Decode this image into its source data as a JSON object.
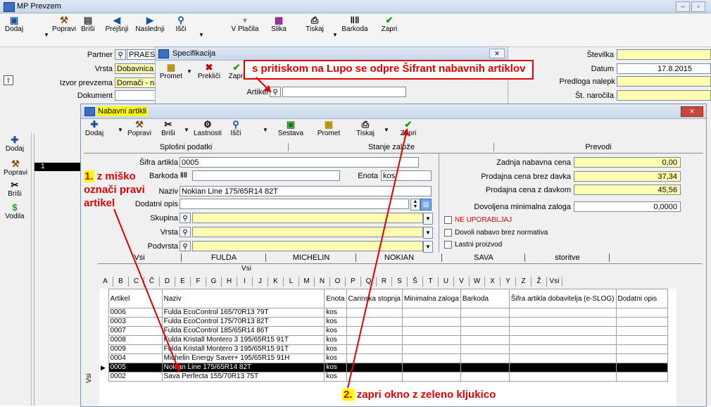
{
  "main_window": {
    "title": "MP Prevzem",
    "toolbar": [
      {
        "label": "Dodaj",
        "icon": "add-doc-icon"
      },
      {
        "label": "Popravi",
        "icon": "hammer-icon"
      },
      {
        "label": "Briši",
        "icon": "delete-icon"
      },
      {
        "label": "Prejšnji",
        "icon": "prev-arrow-icon"
      },
      {
        "label": "Naslednji",
        "icon": "next-arrow-icon"
      },
      {
        "label": "Išči",
        "icon": "search-icon"
      },
      {
        "label": "V Plačila",
        "icon": "pay-icon"
      },
      {
        "label": "Slika",
        "icon": "picture-icon"
      },
      {
        "label": "Tiskaj",
        "icon": "print-icon"
      },
      {
        "label": "Barkoda",
        "icon": "barcode-icon"
      },
      {
        "label": "Zapri",
        "icon": "checkmark-icon"
      }
    ],
    "fields": {
      "partner_label": "Partner",
      "partner_value": "PRAEST",
      "vrsta_label": "Vrsta",
      "vrsta_value": "Dobavnica",
      "izvor_label": "Izvor prevzema",
      "izvor_value": "Domači - na",
      "dokument_label": "Dokument"
    },
    "right_fields": {
      "stevilka_label": "Številka",
      "datum_label": "Datum",
      "datum_value": "17.8.2015",
      "predloga_label": "Predloga nalepk",
      "narocila_label": "Št. naročila"
    },
    "side_toolbar": [
      {
        "label": "Dodaj",
        "icon": "plus-icon"
      },
      {
        "label": "Popravi",
        "icon": "hammer-icon"
      },
      {
        "label": "Briši",
        "icon": "scissors-icon"
      },
      {
        "label": "Vodila",
        "icon": "dollar-icon"
      }
    ],
    "grid_row_number": "1"
  },
  "spec_window": {
    "title": "Specifikacija",
    "toolbar": [
      {
        "label": "Promet"
      },
      {
        "label": "Prekliči"
      },
      {
        "label": "Zapri"
      }
    ],
    "artikel_label": "Artikel"
  },
  "dialog": {
    "title": "Nabavni artikli",
    "toolbar": [
      {
        "label": "Dodaj",
        "icon": "plus-icon"
      },
      {
        "label": "Popravi",
        "icon": "hammer-icon"
      },
      {
        "label": "Briši",
        "icon": "scissors-icon"
      },
      {
        "label": "Lastnosti",
        "icon": "properties-icon"
      },
      {
        "label": "Išči",
        "icon": "search-icon"
      },
      {
        "label": "Sestava",
        "icon": "composition-icon"
      },
      {
        "label": "Promet",
        "icon": "promet-icon"
      },
      {
        "label": "Tiskaj",
        "icon": "print-icon"
      },
      {
        "label": "Zapri",
        "icon": "checkmark-icon"
      }
    ],
    "section_tabs": [
      "Splošni podatki",
      "Stanje založe",
      "Prevodi"
    ],
    "form": {
      "sifra_label": "Šifra artikla",
      "sifra_value": "0005",
      "barkoda_label": "Barkoda",
      "barkoda_value": "",
      "enota_label": "Enota",
      "enota_value": "kos",
      "naziv_label": "Naziv",
      "naziv_value": "Nokian Line 175/65R14 82T",
      "opis_label": "Dodatni opis",
      "skupina_label": "Skupina",
      "vrsta_label": "Vrsta",
      "podvrsta_label": "Podvrsta"
    },
    "prices": {
      "nabavna_label": "Zadnja nabavna cena",
      "nabavna_value": "0,00",
      "prodajna_label": "Prodajna cena brez davka",
      "prodajna_value": "37,34",
      "davek_label": "Prodajna cena z davkom",
      "davek_value": "45,56",
      "zaloga_label": "Dovoljena minimalna zaloga",
      "zaloga_value": "0,0000"
    },
    "checkboxes": [
      {
        "label": "NE UPORABLJAJ",
        "color": "#e00000"
      },
      {
        "label": "Dovoli nabavo brez normativa",
        "color": "#000000"
      },
      {
        "label": "Lastni proizvod",
        "color": "#000000"
      }
    ],
    "brand_tabs": [
      "Vsi",
      "FULDA",
      "MICHELIN",
      "NOKIAN",
      "SAVA",
      "storitve"
    ],
    "sub_tab": "Vsi",
    "letters": [
      "A",
      "B",
      "C",
      "Č",
      "D",
      "E",
      "F",
      "G",
      "H",
      "I",
      "J",
      "K",
      "L",
      "M",
      "N",
      "O",
      "P",
      "Q",
      "R",
      "S",
      "Š",
      "T",
      "U",
      "V",
      "W",
      "X",
      "Y",
      "Z",
      "Ž",
      "Vsi"
    ],
    "side_label": "Vsi",
    "columns": [
      "Artikel",
      "Naziv",
      "Enota",
      "Carinska stopnja",
      "Minimalna zaloga",
      "Barkoda",
      "Šifra artikla dobavitelja (e-SLOG)",
      "Dodatni opis"
    ],
    "rows": [
      {
        "artikel": "0006",
        "naziv": "Fulda EcoControl 165/70R13 79T",
        "enota": "kos"
      },
      {
        "artikel": "0003",
        "naziv": "Fulda EcoControl 175/70R13 82T",
        "enota": "kos"
      },
      {
        "artikel": "0007",
        "naziv": "Fulda EcoControl 185/65R14 86T",
        "enota": "kos"
      },
      {
        "artikel": "0008",
        "naziv": "Fulda Kristall Montero 3 195/65R15 91T",
        "enota": "kos"
      },
      {
        "artikel": "0009",
        "naziv": "Fulda Kristall Montero 3 195/65R15 91T",
        "enota": "kos"
      },
      {
        "artikel": "0004",
        "naziv": "Michelin Energy Saver+ 195/65R15 91H",
        "enota": "kos"
      },
      {
        "artikel": "0005",
        "naziv": "Nokian Line 175/65R14 82T",
        "enota": "kos",
        "selected": true
      },
      {
        "artikel": "0002",
        "naziv": "Sava Perfecta 155/70R13 75T",
        "enota": "kos"
      }
    ]
  },
  "annotations": {
    "top": "s pritiskom na Lupo se odpre Šifrant nabavnih artiklov",
    "step1_num": "1.",
    "step1_a": "z miško",
    "step1_b": "označi pravi",
    "step1_c": "artikel",
    "step2_num": "2.",
    "step2_text": "zapri okno z zeleno kljukico"
  },
  "colors": {
    "annotation": "#e00000",
    "highlight": "#ffff00",
    "field_yellow": "#fffeb0"
  }
}
